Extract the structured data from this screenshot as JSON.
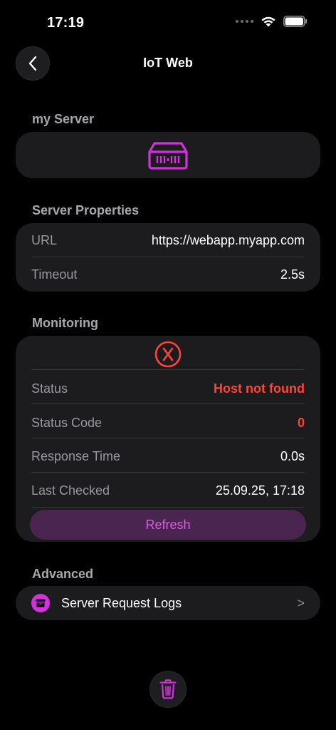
{
  "status_bar": {
    "time": "17:19"
  },
  "nav": {
    "title": "IoT Web",
    "back_icon": "chevron-left-icon"
  },
  "server_section": {
    "header": "my Server",
    "icon": "server-icon"
  },
  "properties": {
    "header": "Server Properties",
    "rows": [
      {
        "label": "URL",
        "value": "https://webapp.myapp.com"
      },
      {
        "label": "Timeout",
        "value": "2.5s"
      }
    ]
  },
  "monitoring": {
    "header": "Monitoring",
    "status_icon": "error-x-icon",
    "rows": [
      {
        "label": "Status",
        "value": "Host not found"
      },
      {
        "label": "Status Code",
        "value": "0"
      },
      {
        "label": "Response Time",
        "value": "0.0s"
      },
      {
        "label": "Last Checked",
        "value": "25.09.25, 17:18"
      }
    ],
    "refresh_label": "Refresh"
  },
  "advanced": {
    "header": "Advanced",
    "logs_label": "Server Request Logs",
    "logs_chevron": ">",
    "logs_icon": "archive-box-icon"
  },
  "delete_icon": "trash-icon",
  "colors": {
    "accent": "#d62fe0",
    "error": "#ff453a",
    "card": "#1c1c1e",
    "background": "#000000"
  }
}
